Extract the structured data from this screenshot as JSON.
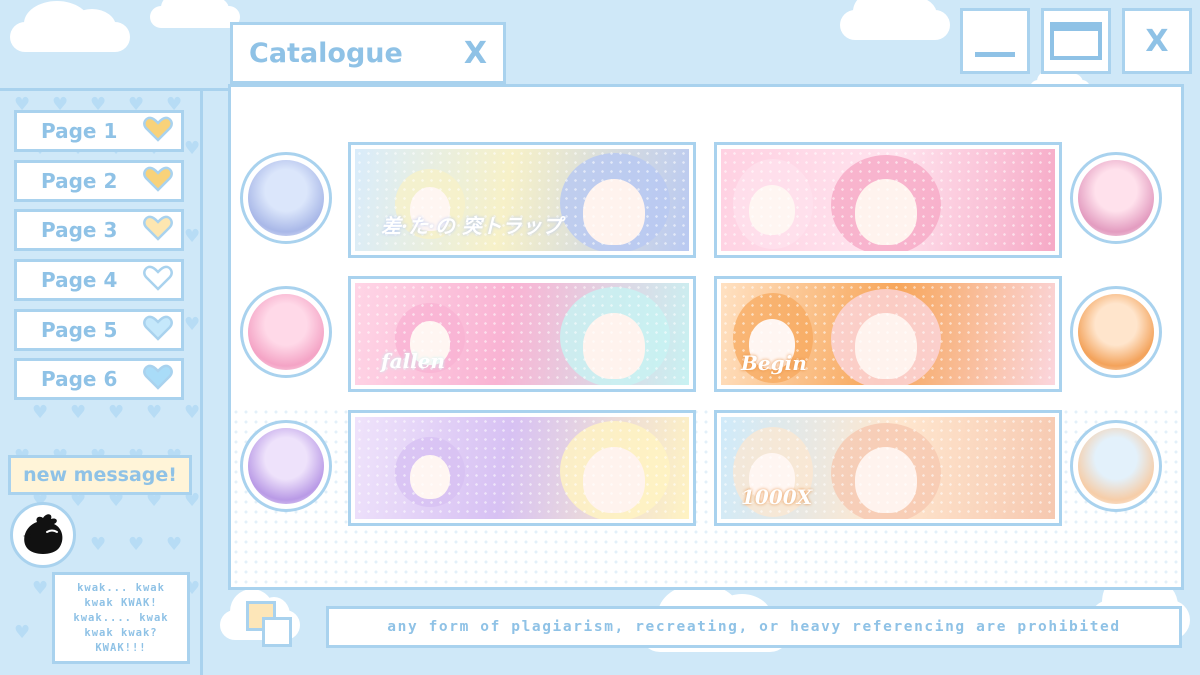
{
  "window": {
    "title": "Catalogue",
    "title_close": "X",
    "controls": {
      "close": "X"
    }
  },
  "sidebar": {
    "pages": [
      {
        "label": "Page 1",
        "heart_color": "#f8d27a"
      },
      {
        "label": "Page 2",
        "heart_color": "#f8d27a"
      },
      {
        "label": "Page 3",
        "heart_color": "#fde6b0"
      },
      {
        "label": "Page 4",
        "heart_color": "#ffffff"
      },
      {
        "label": "Page 5",
        "heart_color": "#c5e8fb"
      },
      {
        "label": "Page 6",
        "heart_color": "#a9dcf8"
      }
    ],
    "new_message": "new message!",
    "bubble_lines": [
      "kwak... kwak",
      "kwak KWAK!",
      "kwak.... kwak",
      "kwak kwak?",
      "KWAK!!!"
    ]
  },
  "footer": {
    "notice": "any form of plagiarism, recreating, or heavy referencing are prohibited"
  },
  "colors": {
    "background": "#cfe8f8",
    "border": "#a9d2ee",
    "text": "#8fc2e6",
    "new_message_bg": "#fff4d8"
  },
  "catalogue": {
    "rows": [
      {
        "left_banner_text": "差·た·の 突トラップ",
        "left_banner_colors": [
          "#d9ecfb",
          "#f7f1c8",
          "#b9c9f2"
        ],
        "right_banner_text": "",
        "right_banner_colors": [
          "#ffd1e2",
          "#ffe3ee",
          "#f6a9c6"
        ],
        "left_icon_colors": [
          "#dbe6fb",
          "#a9b8e8"
        ],
        "right_icon_colors": [
          "#ffe1ec",
          "#e39cc0"
        ]
      },
      {
        "left_banner_text": "fallen",
        "left_banner_colors": [
          "#ffd5e6",
          "#f9b3d3",
          "#c8f2f2"
        ],
        "right_banner_text": "Begin",
        "right_banner_colors": [
          "#ffe1c2",
          "#f7a65a",
          "#fbd6de"
        ],
        "left_icon_colors": [
          "#ffd9e8",
          "#f4a3c5"
        ],
        "right_icon_colors": [
          "#ffe5cc",
          "#f3a25a"
        ]
      },
      {
        "left_banner_text": "",
        "left_banner_colors": [
          "#efe3fb",
          "#d7c1f3",
          "#fff3c2"
        ],
        "right_banner_text": "1000X",
        "right_banner_colors": [
          "#cfeafa",
          "#ffe7cf",
          "#f6c8b0"
        ],
        "left_icon_colors": [
          "#eee2fb",
          "#b99ae6"
        ],
        "right_icon_colors": [
          "#e3f1fb",
          "#f6cda8"
        ]
      }
    ]
  }
}
